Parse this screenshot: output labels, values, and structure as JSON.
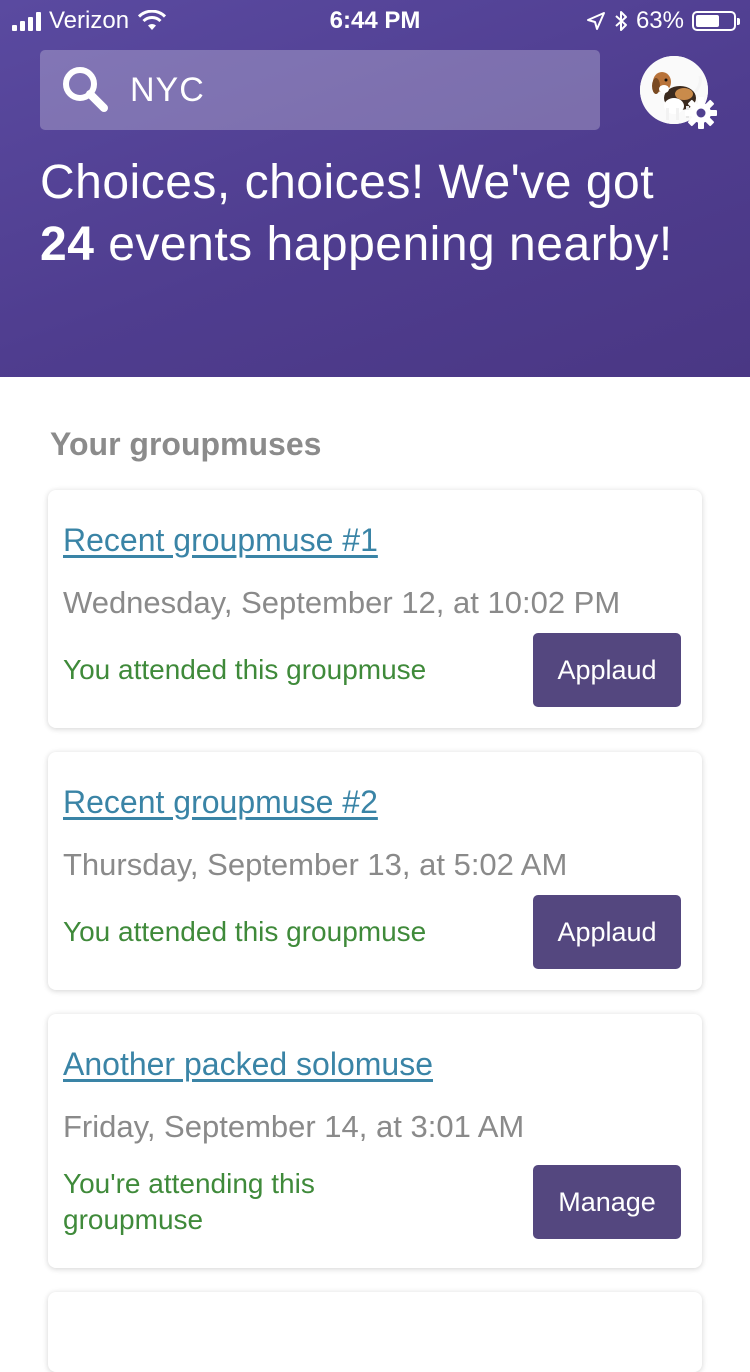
{
  "status_bar": {
    "carrier": "Verizon",
    "time": "6:44 PM",
    "battery": "63%",
    "battery_level": 0.63
  },
  "search": {
    "value": "NYC"
  },
  "headline": {
    "prefix": "Choices, choices! We've got",
    "count": "24",
    "suffix": "events happening nearby!"
  },
  "section": {
    "title": "Your groupmuses"
  },
  "cards": [
    {
      "title": "Recent groupmuse #1",
      "date": "Wednesday, September 12, at 10:02 PM",
      "status": "You attended this groupmuse",
      "button": "Applaud"
    },
    {
      "title": "Recent groupmuse #2",
      "date": "Thursday, September 13, at 5:02 AM",
      "status": "You attended this groupmuse",
      "button": "Applaud"
    },
    {
      "title": "Another packed solomuse",
      "date": "Friday, September 14, at 3:01 AM",
      "status": "You're attending this groupmuse",
      "button": "Manage"
    }
  ],
  "colors": {
    "header_bg": "#50408f",
    "link": "#3a84a6",
    "status_green": "#3f8a3a",
    "button_bg": "#54477f",
    "muted_text": "#8a8a8a"
  },
  "icons": {
    "search": "search-icon",
    "settings": "gear-icon",
    "avatar": "beagle-dog-avatar",
    "location": "location-arrow-icon",
    "bluetooth": "bluetooth-icon",
    "wifi": "wifi-icon"
  }
}
